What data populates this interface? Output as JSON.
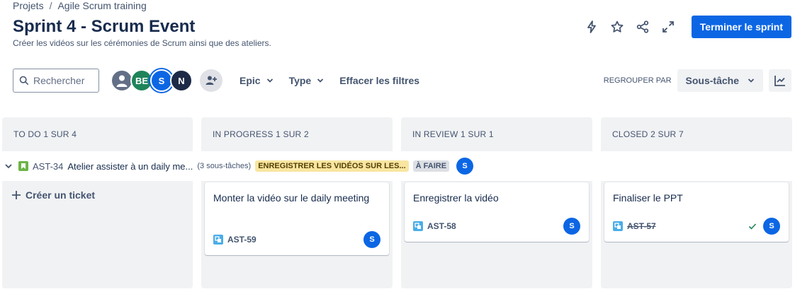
{
  "breadcrumb": {
    "projects": "Projets",
    "separator": "/",
    "project": "Agile Scrum training"
  },
  "header": {
    "title": "Sprint 4 - Scrum Event",
    "subtitle": "Créer les vidéos sur les cérémonies de Scrum ainsi que des ateliers.",
    "complete_sprint": "Terminer le sprint"
  },
  "toolbar": {
    "search_placeholder": "Rechercher",
    "avatars": [
      "BE",
      "S",
      "N"
    ],
    "filters": [
      "Epic",
      "Type"
    ],
    "clear_filters": "Effacer les filtres",
    "group_by_label": "REGROUPER PAR",
    "group_by_value": "Sous-tâche"
  },
  "columns": [
    {
      "label": "TO DO 1 SUR 4"
    },
    {
      "label": "IN PROGRESS 1 SUR 2"
    },
    {
      "label": "IN REVIEW 1 SUR 1"
    },
    {
      "label": "CLOSED 2 SUR 7"
    }
  ],
  "swimlane": {
    "key": "AST-34",
    "title": "Atelier assister à un daily me...",
    "count": "(3 sous-tâches)",
    "parent_badge": "ENREGISTRER LES VIDÉOS SUR LES...",
    "status": "À FAIRE",
    "assignee": "S"
  },
  "create_ticket": "Créer un ticket",
  "cards": [
    {
      "title": "Monter la vidéo sur le daily meeting",
      "key": "AST-59",
      "assignee": "S"
    },
    {
      "title": "Enregistrer la vidéo",
      "key": "AST-58",
      "assignee": "S"
    },
    {
      "title": "Finaliser le PPT",
      "key": "AST-57",
      "assignee": "S"
    }
  ],
  "colors": {
    "primary": "#0c66e4",
    "column_bg": "#f1f2f4",
    "story_green": "#6cb547",
    "subtask_blue": "#4bade8"
  }
}
